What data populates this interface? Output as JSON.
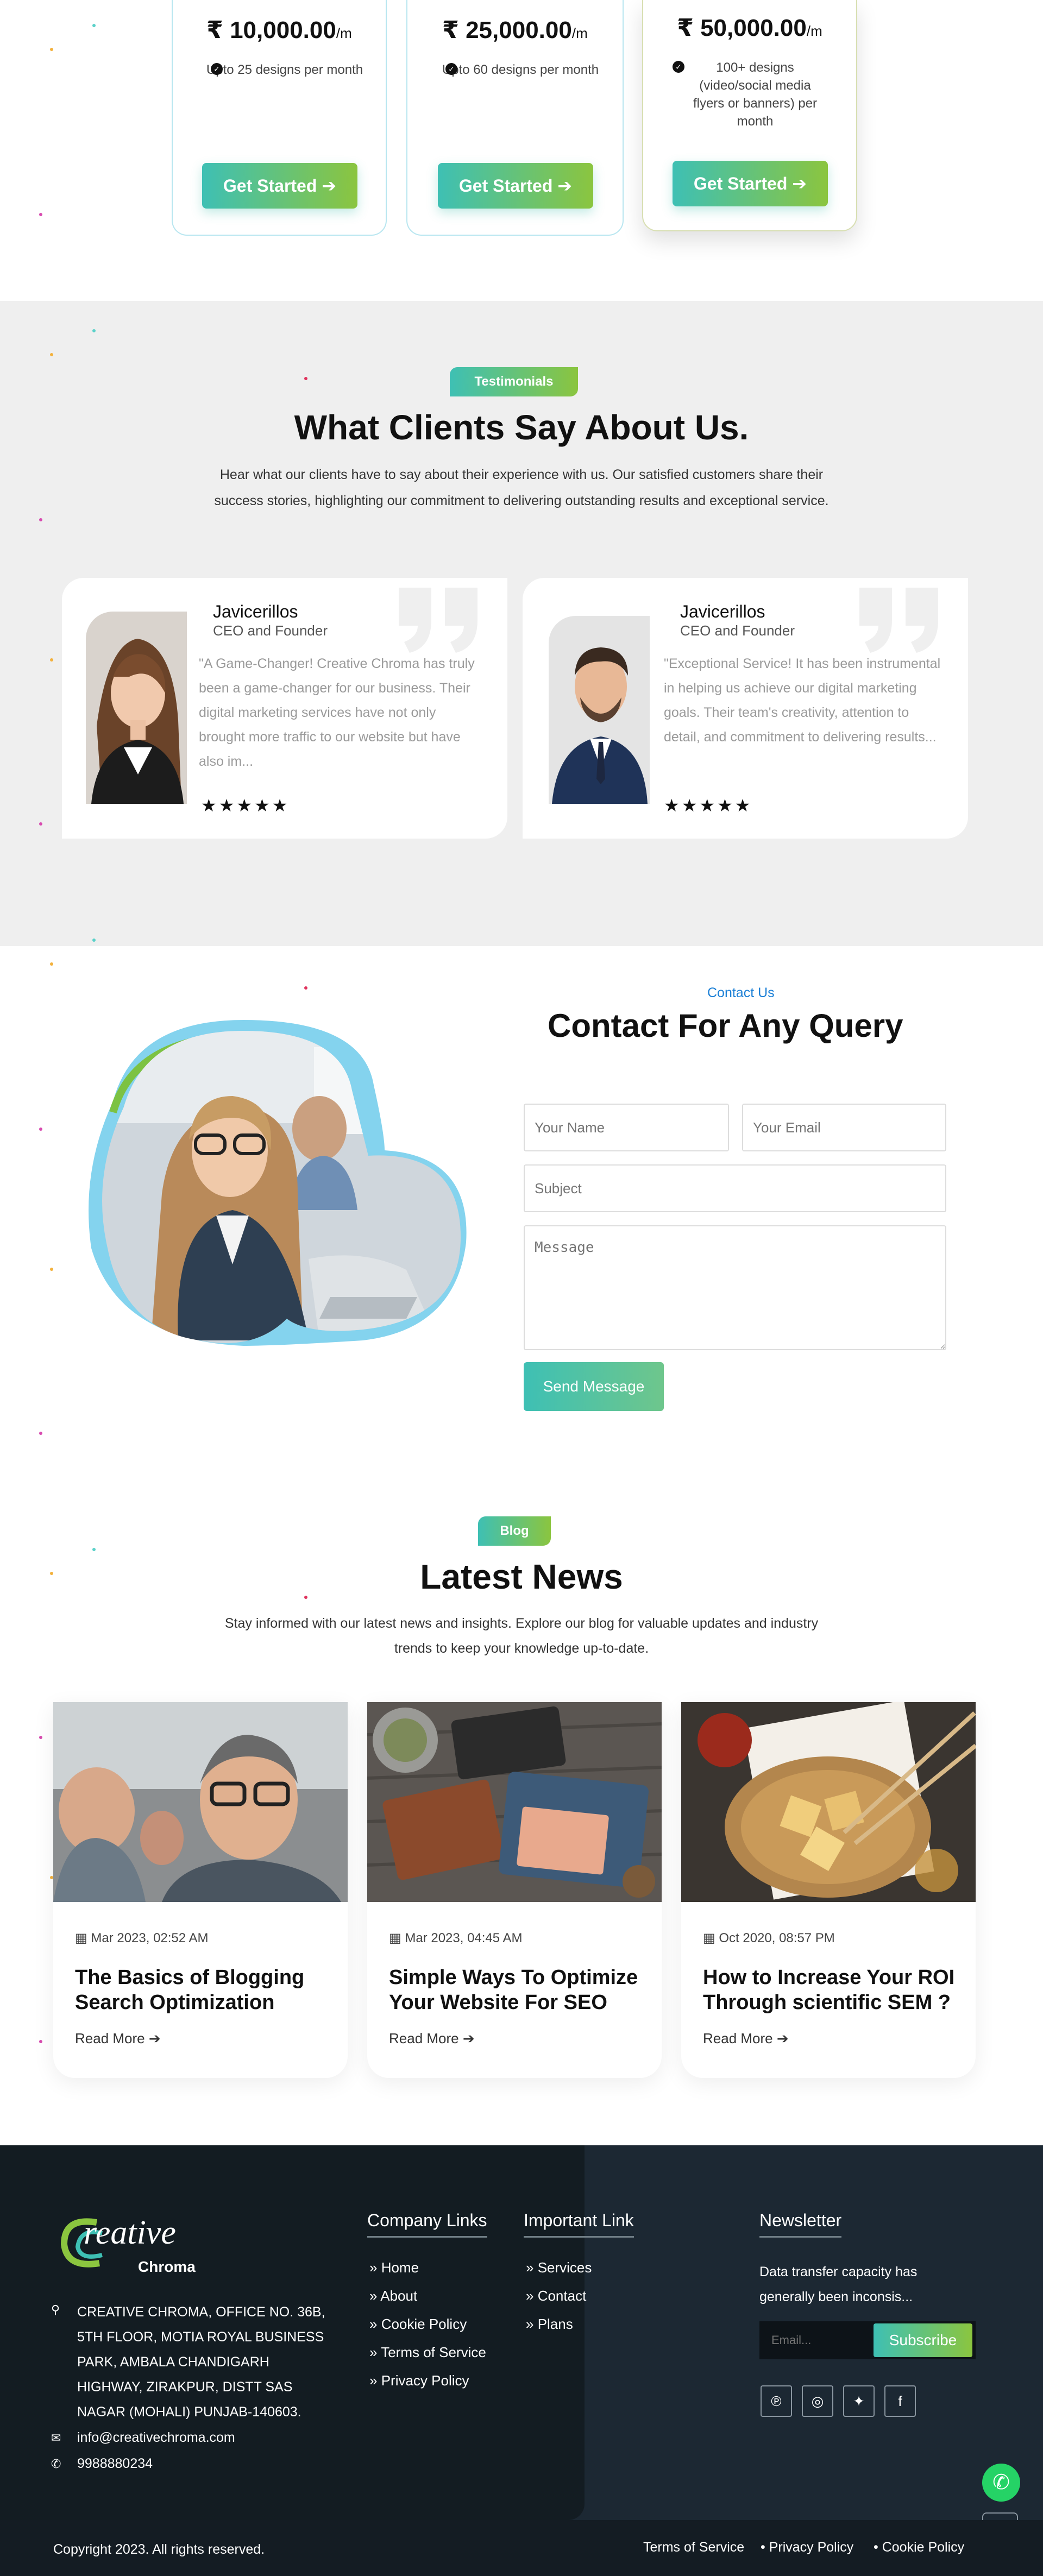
{
  "pricing": {
    "plans": [
      {
        "price": "₹ 10,000.00",
        "unit": "/m",
        "feature": "Upto 25 designs per month",
        "button": "Get Started ➔"
      },
      {
        "price": "₹ 25,000.00",
        "unit": "/m",
        "feature": "Upto 60 designs per month",
        "button": "Get Started ➔"
      },
      {
        "price": "₹ 50,000.00",
        "unit": "/m",
        "feature": "100+ designs (video/social media flyers or banners) per month",
        "button": "Get Started ➔"
      }
    ]
  },
  "testimonials": {
    "badge": "Testimonials",
    "title": "What Clients Say About Us.",
    "lead": "Hear what our clients have to say about their experience with us. Our satisfied customers share their success stories, highlighting our commitment to delivering outstanding results and exceptional service.",
    "items": [
      {
        "name": "Javicerillos",
        "role": "CEO and Founder",
        "text": "\"A Game-Changer! Creative Chroma has truly been a game-changer for our business. Their digital marketing services have not only brought more traffic to our website but have also im...",
        "stars": "★★★★★"
      },
      {
        "name": "Javicerillos",
        "role": "CEO and Founder",
        "text": "\"Exceptional Service! It has been instrumental in helping us achieve our digital marketing goals. Their team's creativity, attention to detail, and commitment to delivering results...",
        "stars": "★★★★★"
      }
    ]
  },
  "contact": {
    "eyebrow": "Contact Us",
    "title": "Contact For Any Query",
    "name_placeholder": "Your Name",
    "email_placeholder": "Your Email",
    "subject_placeholder": "Subject",
    "message_placeholder": "Message",
    "send": "Send Message"
  },
  "blog": {
    "badge": "Blog",
    "title": "Latest News",
    "lead": "Stay informed with our latest news and insights. Explore our blog for valuable updates and industry trends to keep your knowledge up-to-date.",
    "posts": [
      {
        "date": "Mar 2023, 02:52 AM",
        "title": "The Basics of Blogging Search Optimization",
        "more": "Read More ➔"
      },
      {
        "date": "Mar 2023, 04:45 AM",
        "title": "Simple Ways To Optimize Your Website For SEO",
        "more": "Read More ➔"
      },
      {
        "date": "Oct 2020, 08:57 PM",
        "title": "How to Increase Your ROI Through scientific SEM ?",
        "more": "Read More ➔"
      }
    ]
  },
  "footer": {
    "logo_main": "reative",
    "logo_sub": "Chroma",
    "address": "CREATIVE CHROMA, OFFICE NO. 36B, 5TH FLOOR, MOTIA ROYAL BUSINESS PARK, AMBALA CHANDIGARH HIGHWAY, ZIRAKPUR, DISTT SAS NAGAR (MOHALI) PUNJAB-140603.",
    "email": "info@creativechroma.com",
    "phone": "9988880234",
    "company_heading": "Company Links",
    "company_links": [
      "Home",
      "About",
      "Cookie Policy",
      "Terms of Service",
      "Privacy Policy"
    ],
    "important_heading": "Important Link",
    "important_links": [
      "Services",
      "Contact",
      "Plans"
    ],
    "newsletter_heading": "Newsletter",
    "newsletter_text": "Data transfer capacity has generally been inconsis...",
    "newsletter_placeholder": "Email...",
    "subscribe": "Subscribe",
    "copyright": "Copyright 2023. All rights reserved.",
    "bottom_links": [
      "Terms of Service",
      "Privacy Policy",
      "Cookie Policy"
    ],
    "colors": {
      "accent_start": "#3ec0b4",
      "accent_end": "#8bc53f",
      "footer_bg": "#1c2833"
    }
  }
}
